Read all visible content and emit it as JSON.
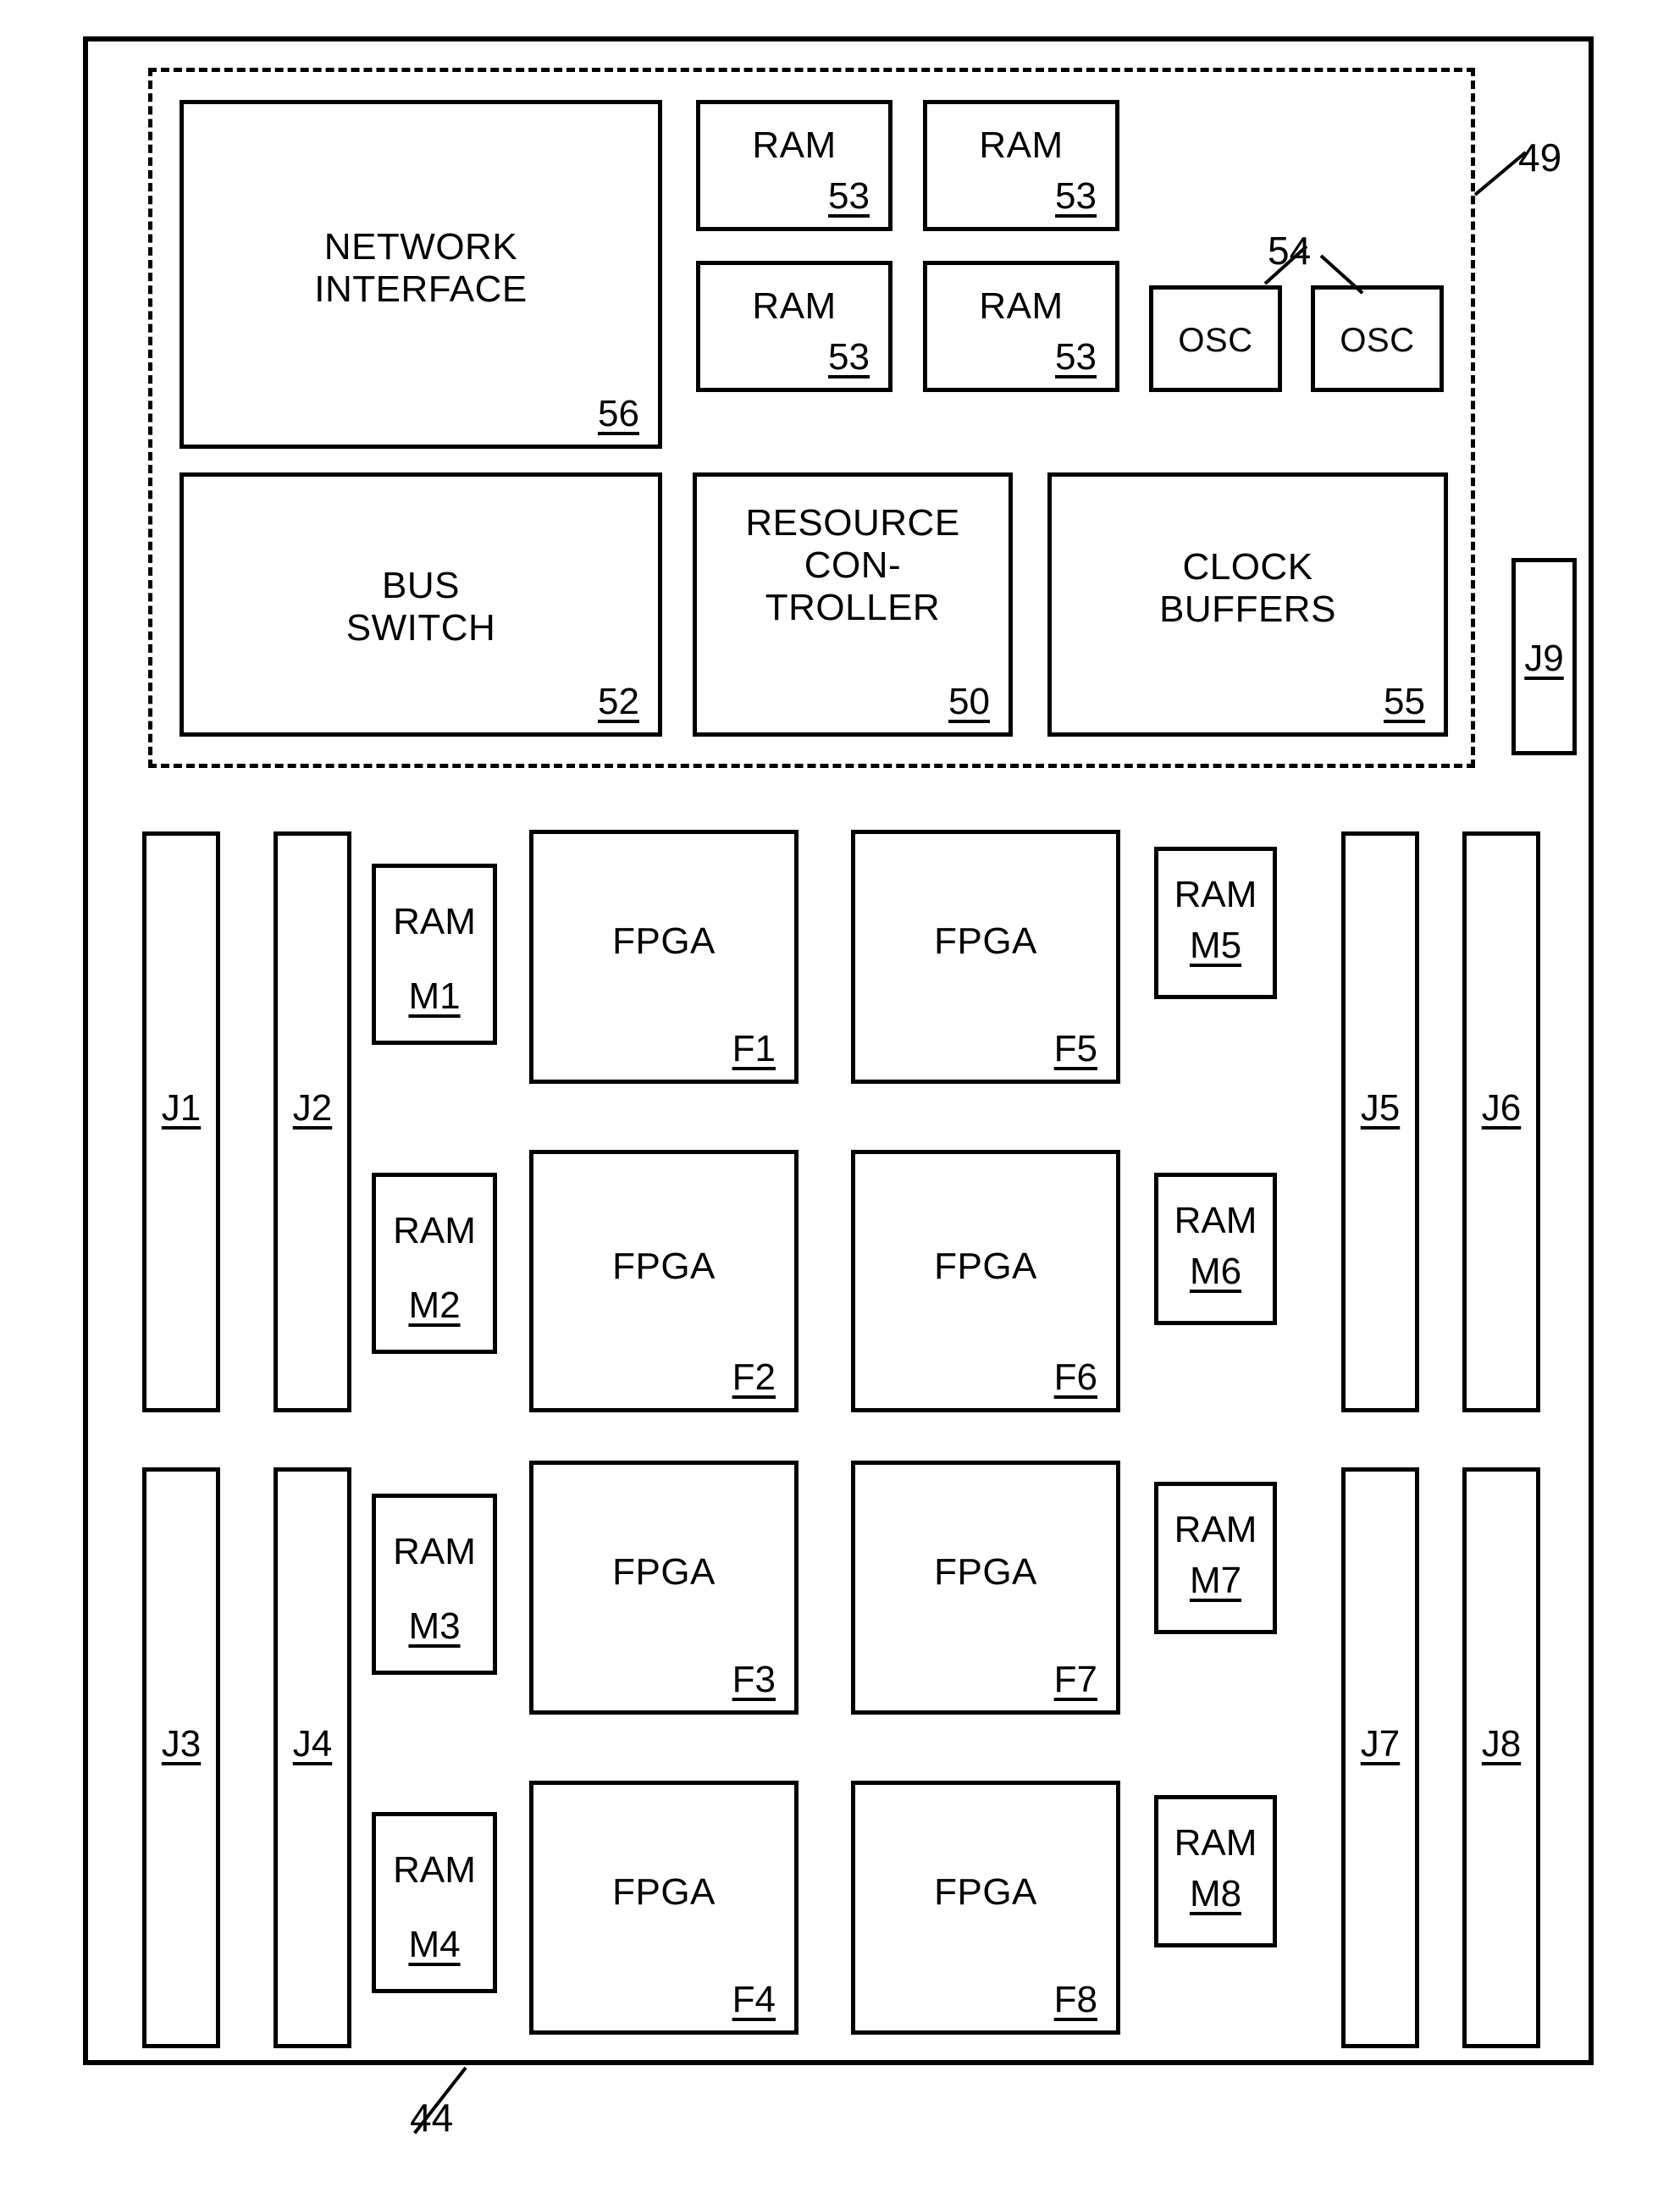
{
  "figure": {
    "board_ref": "44",
    "dashed_region_ref": "49",
    "osc_group_ref": "54"
  },
  "control_section": {
    "network_interface": {
      "label": "NETWORK\nINTERFACE",
      "ref": "56"
    },
    "rams": [
      {
        "label": "RAM",
        "ref": "53"
      },
      {
        "label": "RAM",
        "ref": "53"
      },
      {
        "label": "RAM",
        "ref": "53"
      },
      {
        "label": "RAM",
        "ref": "53"
      }
    ],
    "oscillators": [
      {
        "label": "OSC"
      },
      {
        "label": "OSC"
      }
    ],
    "bus_switch": {
      "label": "BUS\nSWITCH",
      "ref": "52"
    },
    "resource_controller": {
      "label": "RESOURCE\nCON-\nTROLLER",
      "ref": "50"
    },
    "clock_buffers": {
      "label": "CLOCK\nBUFFERS",
      "ref": "55"
    }
  },
  "connectors": [
    {
      "label": "J1"
    },
    {
      "label": "J2"
    },
    {
      "label": "J3"
    },
    {
      "label": "J4"
    },
    {
      "label": "J5"
    },
    {
      "label": "J6"
    },
    {
      "label": "J7"
    },
    {
      "label": "J8"
    },
    {
      "label": "J9"
    }
  ],
  "memories": [
    {
      "label": "RAM",
      "id": "M1"
    },
    {
      "label": "RAM",
      "id": "M2"
    },
    {
      "label": "RAM",
      "id": "M3"
    },
    {
      "label": "RAM",
      "id": "M4"
    },
    {
      "label": "RAM",
      "id": "M5"
    },
    {
      "label": "RAM",
      "id": "M6"
    },
    {
      "label": "RAM",
      "id": "M7"
    },
    {
      "label": "RAM",
      "id": "M8"
    }
  ],
  "fpgas": [
    {
      "label": "FPGA",
      "ref": "F1"
    },
    {
      "label": "FPGA",
      "ref": "F2"
    },
    {
      "label": "FPGA",
      "ref": "F3"
    },
    {
      "label": "FPGA",
      "ref": "F4"
    },
    {
      "label": "FPGA",
      "ref": "F5"
    },
    {
      "label": "FPGA",
      "ref": "F6"
    },
    {
      "label": "FPGA",
      "ref": "F7"
    },
    {
      "label": "FPGA",
      "ref": "F8"
    }
  ]
}
